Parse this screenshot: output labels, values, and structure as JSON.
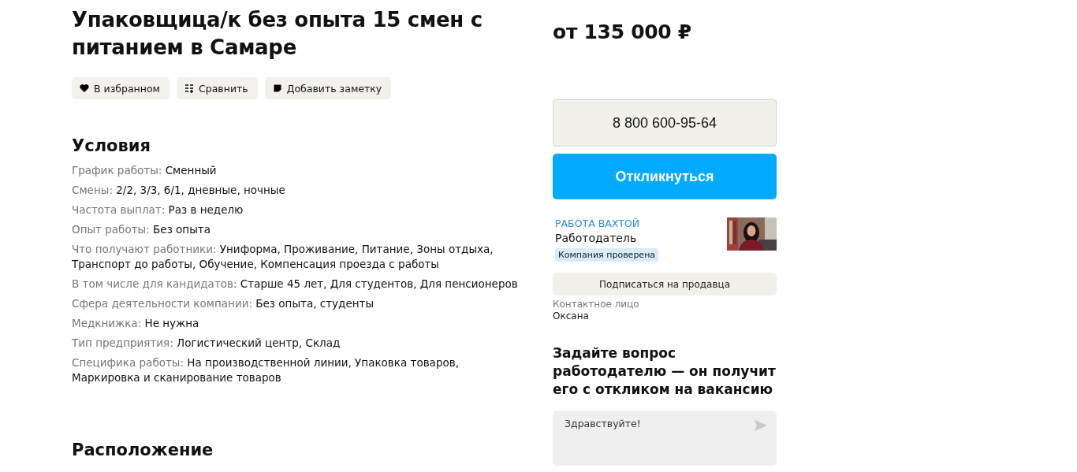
{
  "title": "Упаковщица/к без опыта 15 смен с питанием в Самаре",
  "actions": [
    {
      "kind": "favorite",
      "label": "В избранном",
      "saved": true
    },
    {
      "kind": "compare",
      "label": "Сравнить"
    },
    {
      "kind": "note",
      "label": "Добавить заметку"
    }
  ],
  "conditions": {
    "heading": "Условия",
    "items": [
      {
        "label": "График работы:",
        "value": "Сменный"
      },
      {
        "label": "Смены:",
        "value": "2/2, 3/3, 6/1, дневные, ночные"
      },
      {
        "label": "Частота выплат:",
        "value": "Раз в неделю"
      },
      {
        "label": "Опыт работы:",
        "value": "Без опыта"
      },
      {
        "label": "Что получают работники:",
        "value": "Униформа, Проживание, Питание, Зоны отдыха, Транспорт до работы, Обучение, Компенсация проезда с работы"
      },
      {
        "label": "В том числе для кандидатов:",
        "value": "Старше 45 лет, Для студентов, Для пенсионеров"
      },
      {
        "label": "Сфера деятельности компании:",
        "value": "Без опыта, студенты"
      },
      {
        "label": "Медкнижка:",
        "value": "Не нужна"
      },
      {
        "label": "Тип предприятия:",
        "value": "Логистический центр, Склад"
      },
      {
        "label": "Специфика работы:",
        "value": "На производственной линии, Упаковка товаров, Маркировка и сканирование товаров"
      }
    ]
  },
  "location": {
    "heading": "Расположение"
  },
  "sidebar": {
    "price": "от 135 000 ₽",
    "phone_button": "8 800 600-95-64",
    "apply_button": "Откликнуться",
    "employer": {
      "name": "РАБОТА ВАХТОЙ",
      "role": "Работодатель",
      "badge": "Компания проверена"
    },
    "subscribe_button": "Подписаться на продавца",
    "contact": {
      "label": "Контактное лицо",
      "name": "Оксана"
    },
    "question": {
      "heading": "Задайте вопрос работодателю — он получит его с откликом на вакансию",
      "message": "Здравствуйте!"
    }
  }
}
